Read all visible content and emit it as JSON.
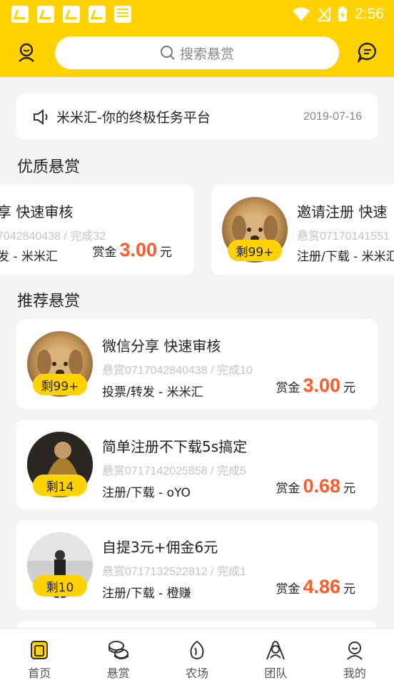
{
  "status_bar": {
    "time": "2:56"
  },
  "header": {
    "search_placeholder": "搜索悬赏"
  },
  "notice": {
    "text": "米米汇-你的终极任务平台",
    "date": "2019-07-16"
  },
  "sections": {
    "featured_title": "优质悬赏",
    "recommended_title": "推荐悬赏"
  },
  "featured": [
    {
      "title": "享 快速审核",
      "sub": "7042840438 / 完成32",
      "tag": "发 - 米米汇",
      "reward_label": "赏金",
      "amount": "3.00",
      "unit": "元"
    },
    {
      "title": "邀请注册 快速",
      "sub": "悬赏07170141551",
      "tag": "注册/下载 - 米米汇",
      "remain": "剩99+"
    }
  ],
  "tasks": [
    {
      "title": "微信分享 快速审核",
      "sub": "悬赏0717042840438 / 完成10",
      "tag": "投票/转发 - 米米汇",
      "remain": "剩99+",
      "reward_label": "赏金",
      "amount": "3.00",
      "unit": "元"
    },
    {
      "title": "简单注册不下载5s搞定",
      "sub": "悬赏0717142025858 / 完成5",
      "tag": "注册/下载 - oYO",
      "remain": "剩14",
      "reward_label": "赏金",
      "amount": "0.68",
      "unit": "元"
    },
    {
      "title": "自提3元+佣金6元",
      "sub": "悬赏0717132522812 / 完成1",
      "tag": "注册/下载 - 橙赚",
      "remain": "剩10",
      "reward_label": "赏金",
      "amount": "4.86",
      "unit": "元"
    }
  ],
  "tabs": [
    {
      "label": "首页",
      "icon": "home-icon"
    },
    {
      "label": "悬赏",
      "icon": "coins-icon"
    },
    {
      "label": "农场",
      "icon": "seed-icon"
    },
    {
      "label": "团队",
      "icon": "team-icon"
    },
    {
      "label": "我的",
      "icon": "user-icon"
    }
  ],
  "colors": {
    "brand": "#ffd200",
    "reward": "#ff5a2a"
  }
}
